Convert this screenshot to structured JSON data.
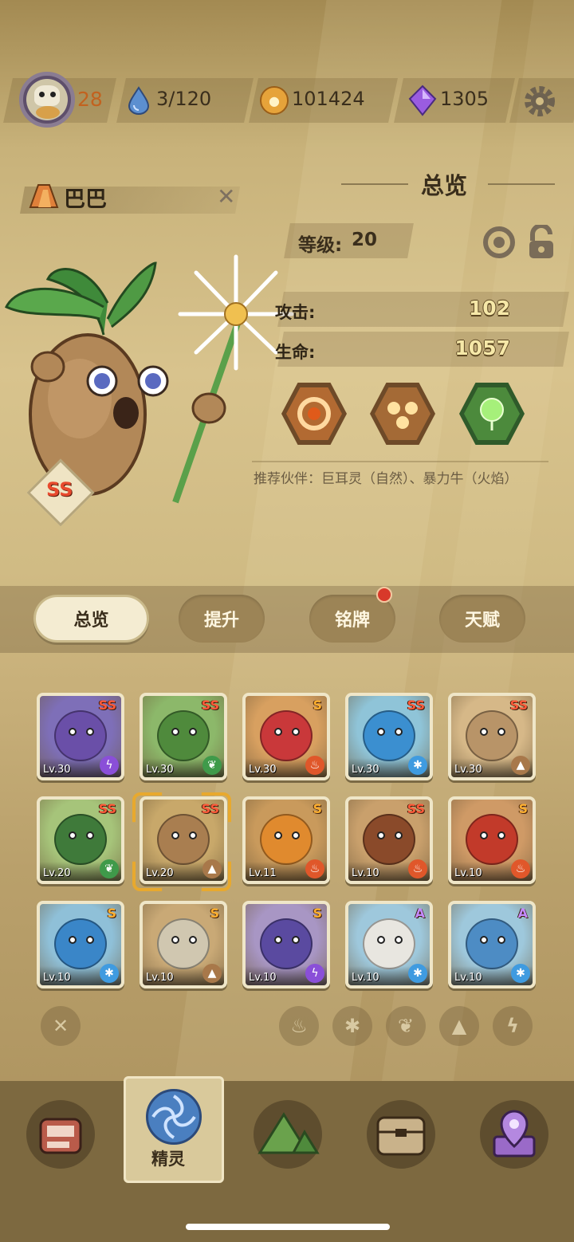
{
  "topbar": {
    "player_level": "28",
    "stamina": "3/120",
    "coins": "101424",
    "gems": "1305",
    "icons": [
      "avatar-skull-icon",
      "water-drop-icon",
      "paw-coin-icon",
      "purple-gem-icon",
      "gear-icon"
    ]
  },
  "spirit": {
    "name": "巴巴",
    "rank": "SS",
    "element_icon": "earth-icon"
  },
  "overview": {
    "title": "总览",
    "level_label": "等级:",
    "level_value": "20",
    "attack_label": "攻击:",
    "attack_value": "102",
    "hp_label": "生命:",
    "hp_value": "1057",
    "skills": [
      "spiral-skill-icon",
      "triple-seed-skill-icon",
      "green-orb-skill-icon"
    ],
    "recommend": "推荐伙伴：巨耳灵（自然）、暴力牛（火焰）"
  },
  "tabs": [
    {
      "label": "总览",
      "active": true
    },
    {
      "label": "提升",
      "active": false
    },
    {
      "label": "铭牌",
      "active": false,
      "badge": true
    },
    {
      "label": "天赋",
      "active": false
    }
  ],
  "spirits": [
    {
      "level": "Lv.30",
      "rank": "SS",
      "element": "electric",
      "bg": "#7e6fb8",
      "body": "#6a4fa8"
    },
    {
      "level": "Lv.30",
      "rank": "SS",
      "element": "nature",
      "bg": "#8cb86a",
      "body": "#4f8a3c"
    },
    {
      "level": "Lv.30",
      "rank": "S",
      "element": "fire",
      "bg": "#d8a060",
      "body": "#c9383a"
    },
    {
      "level": "Lv.30",
      "rank": "SS",
      "element": "ice",
      "bg": "#8fc4d8",
      "body": "#3b8fd0"
    },
    {
      "level": "Lv.30",
      "rank": "SS",
      "element": "earth",
      "bg": "#d6b888",
      "body": "#b89468"
    },
    {
      "level": "Lv.20",
      "rank": "SS",
      "element": "nature",
      "bg": "#a6c47a",
      "body": "#3f7a3a"
    },
    {
      "level": "Lv.20",
      "rank": "SS",
      "element": "earth",
      "bg": "#c8a86a",
      "body": "#a97e50"
    },
    {
      "level": "Lv.11",
      "rank": "S",
      "element": "fire",
      "bg": "#c99a5c",
      "body": "#e08a2e"
    },
    {
      "level": "Lv.10",
      "rank": "SS",
      "element": "fire",
      "bg": "#c9a06c",
      "body": "#8a4a2a"
    },
    {
      "level": "Lv.10",
      "rank": "S",
      "element": "fire",
      "bg": "#cf9a66",
      "body": "#c23a2a"
    },
    {
      "level": "Lv.10",
      "rank": "S",
      "element": "ice",
      "bg": "#8fc0d8",
      "body": "#3a86c8"
    },
    {
      "level": "Lv.10",
      "rank": "S",
      "element": "earth",
      "bg": "#c9a976",
      "body": "#d0c7b0"
    },
    {
      "level": "Lv.10",
      "rank": "S",
      "element": "electric",
      "bg": "#a896c4",
      "body": "#5a4aa0"
    },
    {
      "level": "Lv.10",
      "rank": "A",
      "element": "ice",
      "bg": "#9ec8dc",
      "body": "#e8e6e0"
    },
    {
      "level": "Lv.10",
      "rank": "A",
      "element": "ice",
      "bg": "#9ec8dc",
      "body": "#4d8cc4"
    }
  ],
  "filters": [
    "clear-filter-icon",
    "fire-filter-icon",
    "ice-filter-icon",
    "nature-filter-icon",
    "earth-filter-icon",
    "electric-filter-icon"
  ],
  "nav": {
    "active_label": "精灵",
    "items": [
      "shop-icon",
      "spirit-icon",
      "mountain-icon",
      "chest-icon",
      "map-pin-icon"
    ]
  },
  "colors": {
    "fire": "#e0572a",
    "ice": "#3f9be0",
    "nature": "#3f9a4a",
    "earth": "#a8784a",
    "electric": "#8a4fd8",
    "rank_ss": "#ff5a3a",
    "rank_s": "#ffb030",
    "rank_a": "#c48aff"
  }
}
